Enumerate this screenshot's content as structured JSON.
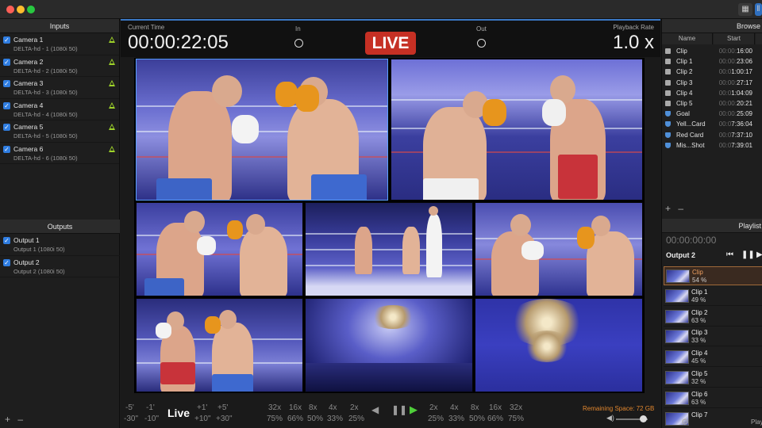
{
  "window": {
    "title_buttons": [
      "grid-view",
      "columns-view"
    ]
  },
  "inputs": {
    "header": "Inputs",
    "items": [
      {
        "name": "Camera 1",
        "sub": "DELTA-hd - 1 (1080i 50)"
      },
      {
        "name": "Camera 2",
        "sub": "DELTA-hd - 2 (1080i 50)"
      },
      {
        "name": "Camera 3",
        "sub": "DELTA-hd - 3 (1080i 50)"
      },
      {
        "name": "Camera 4",
        "sub": "DELTA-hd - 4 (1080i 50)"
      },
      {
        "name": "Camera 5",
        "sub": "DELTA-hd - 5 (1080i 50)"
      },
      {
        "name": "Camera 6",
        "sub": "DELTA-hd - 6 (1080i 50)"
      }
    ]
  },
  "outputs": {
    "header": "Outputs",
    "items": [
      {
        "name": "Output 1",
        "sub": "Output 1 (1080i 50)"
      },
      {
        "name": "Output 2",
        "sub": "Output 2 (1080i 50)"
      }
    ],
    "add": "+",
    "remove": "–"
  },
  "topbar": {
    "current_time_label": "Current Time",
    "current_time": "00:00:22:05",
    "in_label": "In",
    "out_label": "Out",
    "live": "LIVE",
    "rate_label": "Playback Rate",
    "rate": "1.0 x"
  },
  "transport": {
    "jump_top": [
      "-5'",
      "-1'"
    ],
    "jump_bottom": [
      "-30\"",
      "-10\""
    ],
    "jump_top_fwd": [
      "+1'",
      "+5'"
    ],
    "jump_bottom_fwd": [
      "+10\"",
      "+30\""
    ],
    "live": "Live",
    "rev_speeds": [
      "32x",
      "16x",
      "8x",
      "4x",
      "2x"
    ],
    "rev_pcts": [
      "75%",
      "66%",
      "50%",
      "33%",
      "25%"
    ],
    "fwd_speeds": [
      "2x",
      "4x",
      "8x",
      "16x",
      "32x"
    ],
    "fwd_pcts": [
      "25%",
      "33%",
      "50%",
      "66%",
      "75%"
    ],
    "remaining": "Remaining Space: 72 GB",
    "volume": 0.85
  },
  "browser": {
    "header": "Browse",
    "col_name": "Name",
    "col_start": "Start",
    "rows": [
      {
        "icon": "clip-icon",
        "name": "Clip",
        "dim": "00:00:",
        "time": "16:00"
      },
      {
        "icon": "clip-icon",
        "name": "Clip 1",
        "dim": "00:00:",
        "time": "23:06"
      },
      {
        "icon": "clip-icon",
        "name": "Clip 2",
        "dim": "00:0",
        "time": "1:00:17"
      },
      {
        "icon": "clip-icon",
        "name": "Clip 3",
        "dim": "00:00:",
        "time": "27:17"
      },
      {
        "icon": "clip-icon",
        "name": "Clip 4",
        "dim": "00:0",
        "time": "1:04:09"
      },
      {
        "icon": "clip-icon",
        "name": "Clip 5",
        "dim": "00:00:",
        "time": "20:21"
      },
      {
        "icon": "shield-icon",
        "name": "Goal",
        "dim": "00:00:",
        "time": "25:09"
      },
      {
        "icon": "shield-icon",
        "name": "Yell...Card",
        "dim": "00:0",
        "time": "7:36:04"
      },
      {
        "icon": "shield-icon",
        "name": "Red Card",
        "dim": "00:0",
        "time": "7:37:10"
      },
      {
        "icon": "shield-icon",
        "name": "Mis...Shot",
        "dim": "00:0",
        "time": "7:39:01"
      }
    ],
    "add": "+",
    "remove": "–"
  },
  "playlist": {
    "header": "Playlist",
    "time": "00:00:00:00",
    "output": "Output 2",
    "items": [
      {
        "name": "Clip",
        "pct": "54 %",
        "selected": true
      },
      {
        "name": "Clip 1",
        "pct": "49 %"
      },
      {
        "name": "Clip 2",
        "pct": "63 %"
      },
      {
        "name": "Clip 3",
        "pct": "33 %"
      },
      {
        "name": "Clip 4",
        "pct": "45 %"
      },
      {
        "name": "Clip 5",
        "pct": "32 %"
      },
      {
        "name": "Clip 6",
        "pct": "63 %"
      },
      {
        "name": "Clip 7",
        "pct": ""
      }
    ],
    "footer": "Play"
  }
}
